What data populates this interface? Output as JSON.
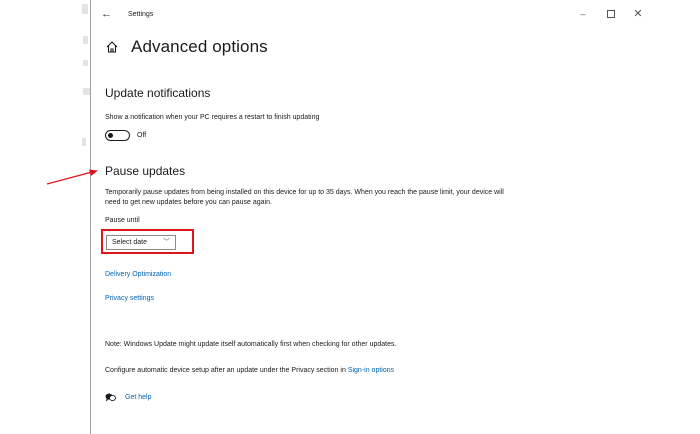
{
  "window": {
    "title": "Settings",
    "back_glyph": "←",
    "minimize_glyph": "–",
    "close_glyph": "✕"
  },
  "header": {
    "icon": "home-icon",
    "title": "Advanced options"
  },
  "update_notifications": {
    "heading": "Update notifications",
    "description": "Show a notification when your PC requires a restart to finish updating",
    "toggle_state": "Off"
  },
  "pause_updates": {
    "heading": "Pause updates",
    "description_line1": "Temporarily pause updates from being installed on this device for up to 35 days. When you reach the pause limit, your device will",
    "description_line2": "need to get new updates before you can pause again.",
    "pause_until_label": "Pause until",
    "select_value": "Select date"
  },
  "links": {
    "delivery_optimization": "Delivery Optimization",
    "privacy_settings": "Privacy settings"
  },
  "notes": {
    "note": "Note: Windows Update might update itself automatically first when checking for other updates.",
    "configure_prefix": "Configure automatic device setup after an update under the Privacy section in ",
    "sign_in_options": "Sign-in options"
  },
  "help": {
    "icon": "get-help-icon",
    "label": "Get help"
  },
  "annotation": {
    "color": "#e0151c"
  },
  "colors": {
    "link": "#0063b1",
    "text": "#1a1a1a"
  }
}
